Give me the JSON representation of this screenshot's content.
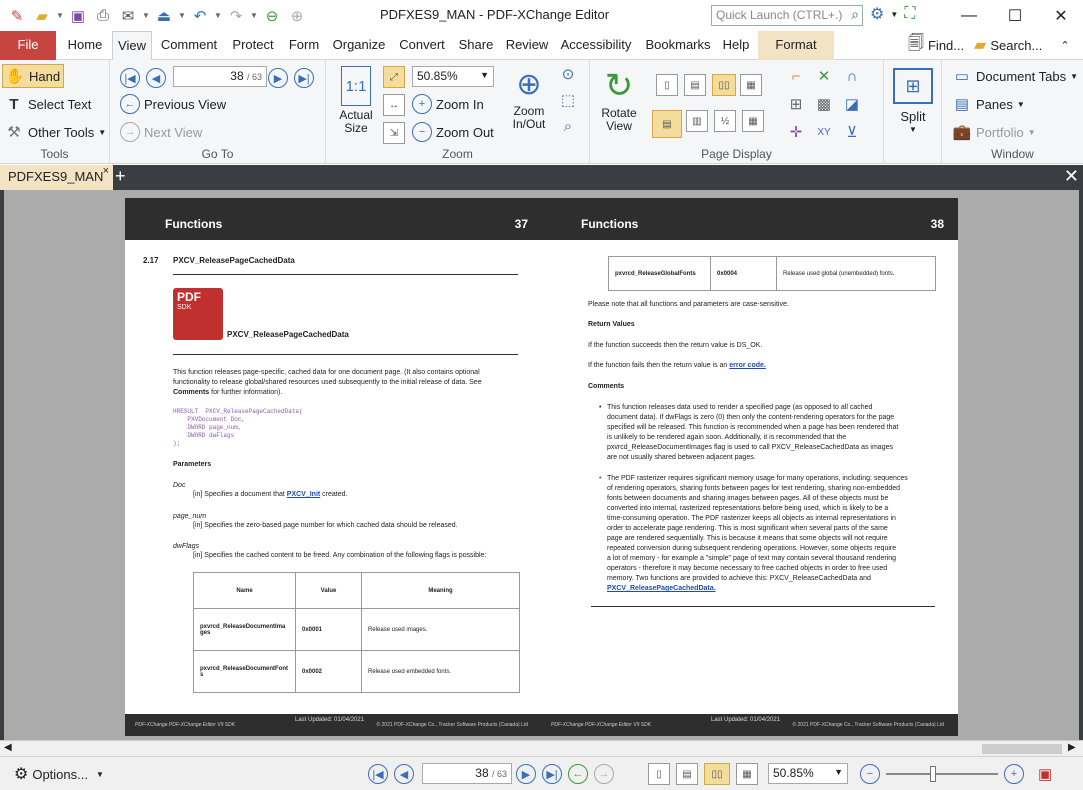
{
  "window": {
    "title": "PDFXES9_MAN - PDF-XChange Editor",
    "quick_launch_placeholder": "Quick Launch (CTRL+.)",
    "minimize": "—",
    "maximize": "☐",
    "close": "✕"
  },
  "menu": {
    "tabs": [
      "File",
      "Home",
      "View",
      "Comment",
      "Protect",
      "Form",
      "Organize",
      "Convert",
      "Share",
      "Review",
      "Accessibility",
      "Bookmarks",
      "Help",
      "Format"
    ],
    "find": "Find...",
    "search": "Search..."
  },
  "ribbon": {
    "tools": {
      "label": "Tools",
      "hand": "Hand",
      "select_text": "Select Text",
      "other_tools": "Other Tools"
    },
    "goto": {
      "label": "Go To",
      "page_value": "38",
      "page_total": "/ 63",
      "previous_view": "Previous View",
      "next_view": "Next View"
    },
    "zoom": {
      "label": "Zoom",
      "actual_size_1": "Actual",
      "actual_size_2": "Size",
      "zoom_value": "50.85%",
      "zoom_in": "Zoom In",
      "zoom_out": "Zoom Out",
      "zoom_inout_1": "Zoom",
      "zoom_inout_2": "In/Out"
    },
    "page_display": {
      "label": "Page Display",
      "rotate_1": "Rotate",
      "rotate_2": "View"
    },
    "split": {
      "label": "Split"
    },
    "window": {
      "label": "Window",
      "document_tabs": "Document Tabs",
      "panes": "Panes",
      "portfolio": "Portfolio"
    }
  },
  "doc_tab": {
    "name": "PDFXES9_MAN",
    "close": "×",
    "add": "+"
  },
  "left_page": {
    "header_title": "Functions",
    "header_num": "37",
    "section_num": "2.17",
    "section_title": "PXCV_ReleasePageCachedData",
    "logo_text": "PDF",
    "logo_sub": "SDK",
    "func_title": "PXCV_ReleasePageCachedData",
    "desc_1": "This function releases page-specific, cached data for one document page. (It also contains optional",
    "desc_2": "functionality to release global/shared resources used subsequently to the initial release of data. See",
    "desc_3_bold": "Comments",
    "desc_3": " for further information).",
    "code_1": "HRESULT  PXCV_ReleasePageCachedData(",
    "code_2": "    PXVDocument Doc,",
    "code_3": "    DWORD page_num,",
    "code_4": "    DWORD dwFlags",
    "code_5": ");",
    "params_heading": "Parameters",
    "p1_name": "Doc",
    "p1_desc": "[in] Specifies a document that ",
    "p1_link": "PXCV_Init",
    "p1_tail": " created.",
    "p2_name": "page_num",
    "p2_desc": "[in] Specifies the zero-based page number for which cached data should be released.",
    "p3_name": "dwFlags",
    "p3_desc": "[in] Specifies the cached content to be freed. Any combination of the following flags is possible:",
    "table_headers": [
      "Name",
      "Value",
      "Meaning"
    ],
    "table_rows": [
      [
        "pxvrcd_ReleaseDocumentImages",
        "0x0001",
        "Release used images."
      ],
      [
        "pxvrcd_ReleaseDocumentFonts",
        "0x0002",
        "Release used embedded fonts."
      ]
    ],
    "footer_left": "PDF-XChange PDF-XChange Editor V9 SDK",
    "footer_mid": "Last Updated: 01/04/2021",
    "footer_right": "© 2021 PDF-XChange Co., Tracker Software Products (Canada) Ltd"
  },
  "right_page": {
    "header_title": "Functions",
    "header_num": "38",
    "table_row": [
      "pxvrcd_ReleaseGlobalFonts",
      "0x0004",
      "Release used global (unembedded) fonts."
    ],
    "note": "Please note that all functions and parameters are case-sensitive.",
    "return_heading": "Return Values",
    "ret_1": "If the function succeeds then the return value is DS_OK.",
    "ret_2": "If the function fails then the return value is an ",
    "ret_2_link": "error code.",
    "comments_heading": "Comments",
    "bullet_1": [
      "This function releases data used to render a specified page (as opposed to all cached",
      "document data). If dwFlags is zero (0) then only the content-rendering operators for the page",
      "specified will be released. This function is recommended when a page has been rendered that",
      "is unlikely to be rendered again soon. Additionally, it is recommended that the",
      "pxvrcd_ReleaseDocumentImages flag is used to call PXCV_ReleaseCachedData as images",
      "are not usually shared between adjacent pages."
    ],
    "bullet_2": [
      "The PDF rasterizer requires significant memory usage for many operations, including: sequences",
      "of rendering operators, sharing fonts between pages for text rendering, sharing non-embedded",
      "fonts between documents and sharing images between pages. All of these objects must be",
      "converted into internal, rasterized representations before being used, which is likely to be a",
      "time-consuming operation. The PDF rasterizer keeps all objects as internal representations in",
      "order to accelerate page rendering. This is most significant when several parts of the same",
      "page are rendered sequentially. This is because it means that some objects will not require",
      "repeated conversion during subsequent rendering operations. However, some objects require",
      "a lot of memory - for example a \"simple\" page of text may contain several thousand rendering",
      "operators - therefore it may become necessary to free cached objects in order to free used",
      "memory. Two functions are provided to achieve this: PXCV_ReleaseCachedData and",
      "PXCV_ReleasePageCachedData."
    ],
    "footer_left": "PDF-XChange PDF-XChange Editor V9 SDK",
    "footer_mid": "Last Updated: 01/04/2021",
    "footer_right": "© 2021 PDF-XChange Co., Tracker Software Products (Canada) Ltd"
  },
  "status": {
    "options": "Options...",
    "page_value": "38",
    "page_total": "/ 63",
    "zoom_value": "50.85%"
  },
  "colors": {
    "file_tab": "#c64540",
    "format_tab": "#f2e3c4",
    "accent": "#3a6fb8",
    "link": "#1f4bb8"
  },
  "icons": [
    "app-logo-icon",
    "open-folder-icon",
    "save-icon",
    "print-icon",
    "email-icon",
    "scan-icon",
    "undo-icon",
    "redo-icon",
    "back-icon",
    "forward-icon",
    "hand-icon",
    "select-text-icon",
    "other-tools-icon",
    "first-page-icon",
    "prev-page-icon",
    "next-page-icon",
    "last-page-icon",
    "zoom-in-icon",
    "zoom-out-icon",
    "rotate-icon",
    "split-icon",
    "document-tabs-icon",
    "panes-icon",
    "portfolio-icon",
    "find-icon",
    "search-icon",
    "gear-icon"
  ]
}
